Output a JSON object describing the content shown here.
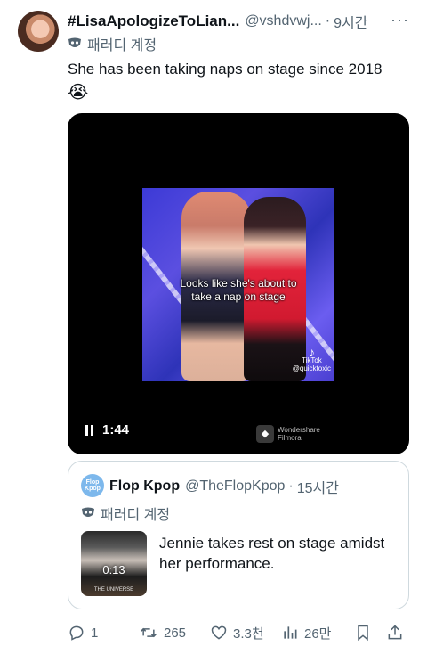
{
  "tweet": {
    "display_name": "#LisaApologizeToLian...",
    "handle": "@vshdvwj...",
    "separator": "·",
    "time": "9시간",
    "more": "···",
    "parody_label": "패러디 계정",
    "text": "She has been taking naps on stage since 2018",
    "emoji": "😭"
  },
  "video": {
    "caption_line1": "Looks like she's about to",
    "caption_line2": "take a nap on stage",
    "tiktok_label": "TikTok",
    "tiktok_user": "@quicktoxic",
    "duration": "1:44",
    "watermark_line1": "Wondershare",
    "watermark_line2": "Filmora"
  },
  "quote": {
    "avatar_text": "Flop Kpop",
    "display_name": "Flop Kpop",
    "handle": "@TheFlopKpop",
    "separator": "·",
    "time": "15시간",
    "parody_label": "패러디 계정",
    "thumb_duration": "0:13",
    "thumb_label": "THE UNIVERSE",
    "text": "Jennie takes rest on stage amidst her performance."
  },
  "actions": {
    "replies": "1",
    "retweets": "265",
    "likes": "3.3천",
    "views": "26만"
  }
}
